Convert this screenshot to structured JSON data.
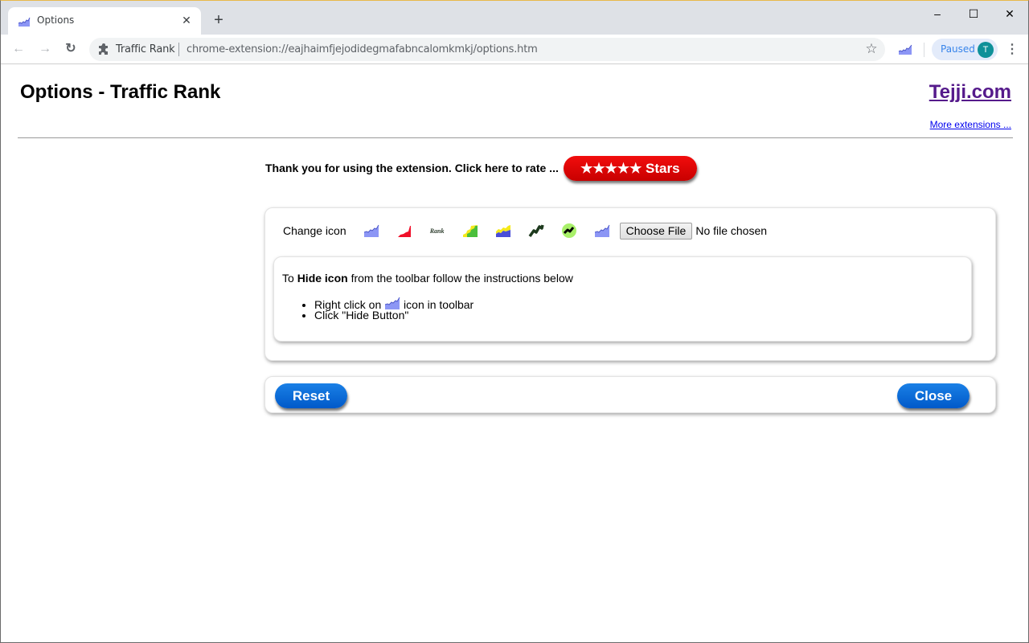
{
  "browser": {
    "tab": {
      "title": "Options",
      "favicon": "traffic-rank-chart-icon"
    },
    "new_tab_symbol": "+",
    "window_controls": {
      "minimize": "–",
      "maximize": "☐",
      "close": "✕"
    },
    "omnibox": {
      "site_label": "Traffic Rank",
      "url": "chrome-extension://eajhaimfjejodidegmafabncalomkmkj/options.htm"
    },
    "profile": {
      "status": "Paused",
      "avatar_initial": "T"
    }
  },
  "page": {
    "title": "Options - Traffic Rank",
    "brand_link": "Tejji.com",
    "more_extensions_link": "More extensions ...",
    "rate": {
      "text": "Thank you for using the extension. Click here to rate ...",
      "button_label": "★★★★★ Stars",
      "button_color": "#e00000"
    },
    "change_icon": {
      "label": "Change icon",
      "options": [
        {
          "name": "blue-area-chart-icon"
        },
        {
          "name": "red-area-chart-icon"
        },
        {
          "name": "rank-text-icon",
          "text": "Rank"
        },
        {
          "name": "yellow-green-step-icon"
        },
        {
          "name": "yellow-blue-step-icon"
        },
        {
          "name": "dark-green-zigzag-icon"
        },
        {
          "name": "green-circle-zigzag-icon"
        },
        {
          "name": "blue-area-chart-icon-alt"
        }
      ],
      "file_button": "Choose File",
      "file_status": "No file chosen"
    },
    "hide_instructions": {
      "prefix": "To ",
      "bold": "Hide icon",
      "suffix": " from the toolbar follow the instructions below",
      "steps": [
        {
          "before": "Right click on ",
          "after": " icon in toolbar"
        },
        {
          "text": "Click \"Hide Button\""
        }
      ]
    },
    "buttons": {
      "reset": "Reset",
      "close": "Close",
      "color": "#0066d6"
    }
  }
}
